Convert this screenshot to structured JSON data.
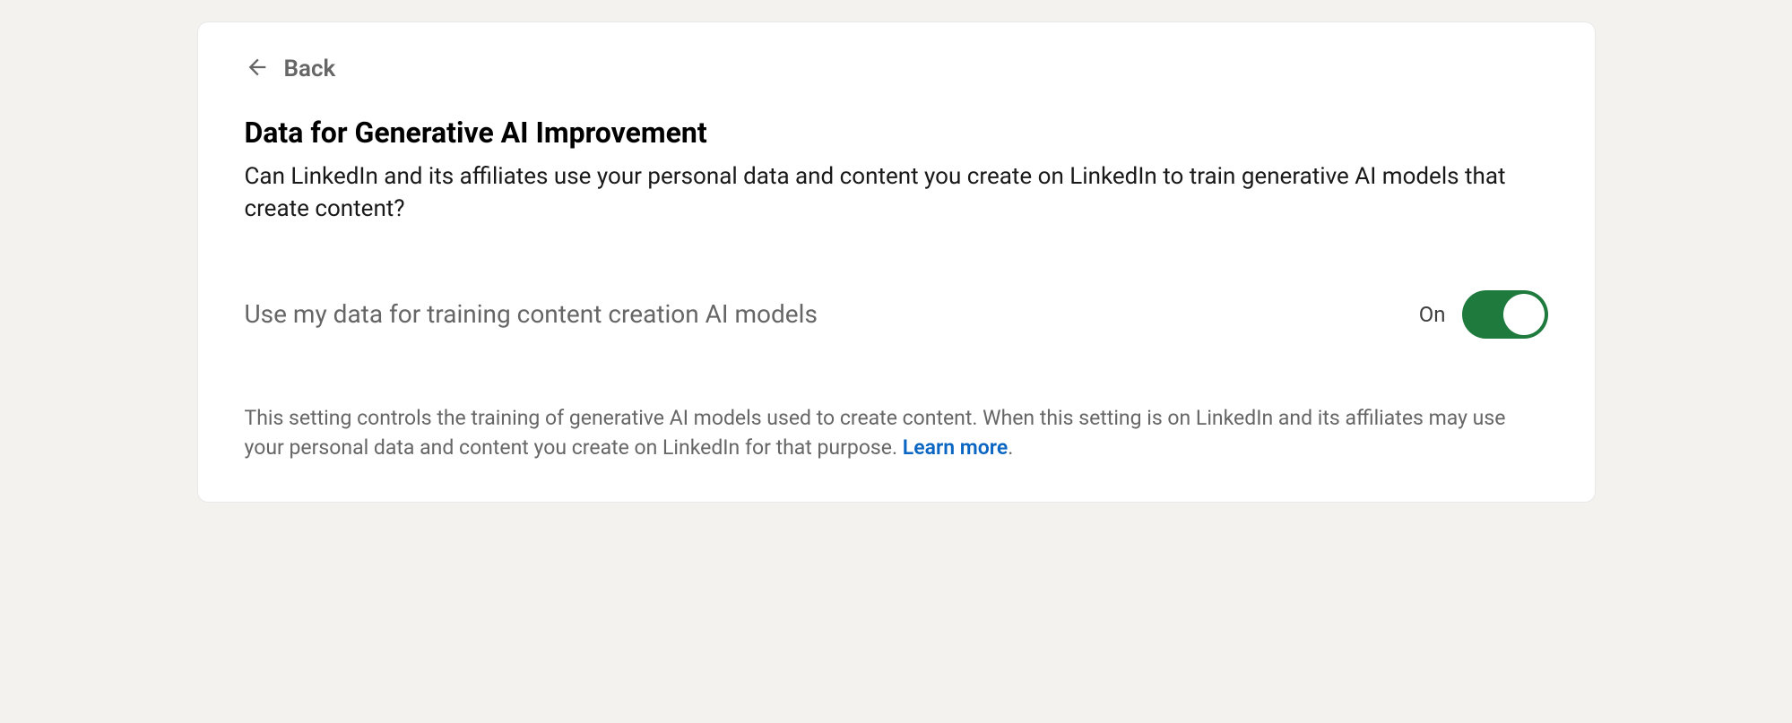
{
  "nav": {
    "back_label": "Back"
  },
  "header": {
    "title": "Data for Generative AI Improvement",
    "description": "Can LinkedIn and its affiliates use your personal data and content you create on LinkedIn to train generative AI models that create content?"
  },
  "setting": {
    "label": "Use my data for training content creation AI models",
    "state_label": "On",
    "enabled": true
  },
  "footer": {
    "text": "This setting controls the training of generative AI models used to create content. When this setting is on LinkedIn and its affiliates may use your personal data and content you create on LinkedIn for that purpose. ",
    "learn_more_label": "Learn more",
    "period": "."
  },
  "colors": {
    "toggle_on": "#1f7a3e",
    "link": "#0a66c2",
    "background": "#f3f2ef"
  }
}
